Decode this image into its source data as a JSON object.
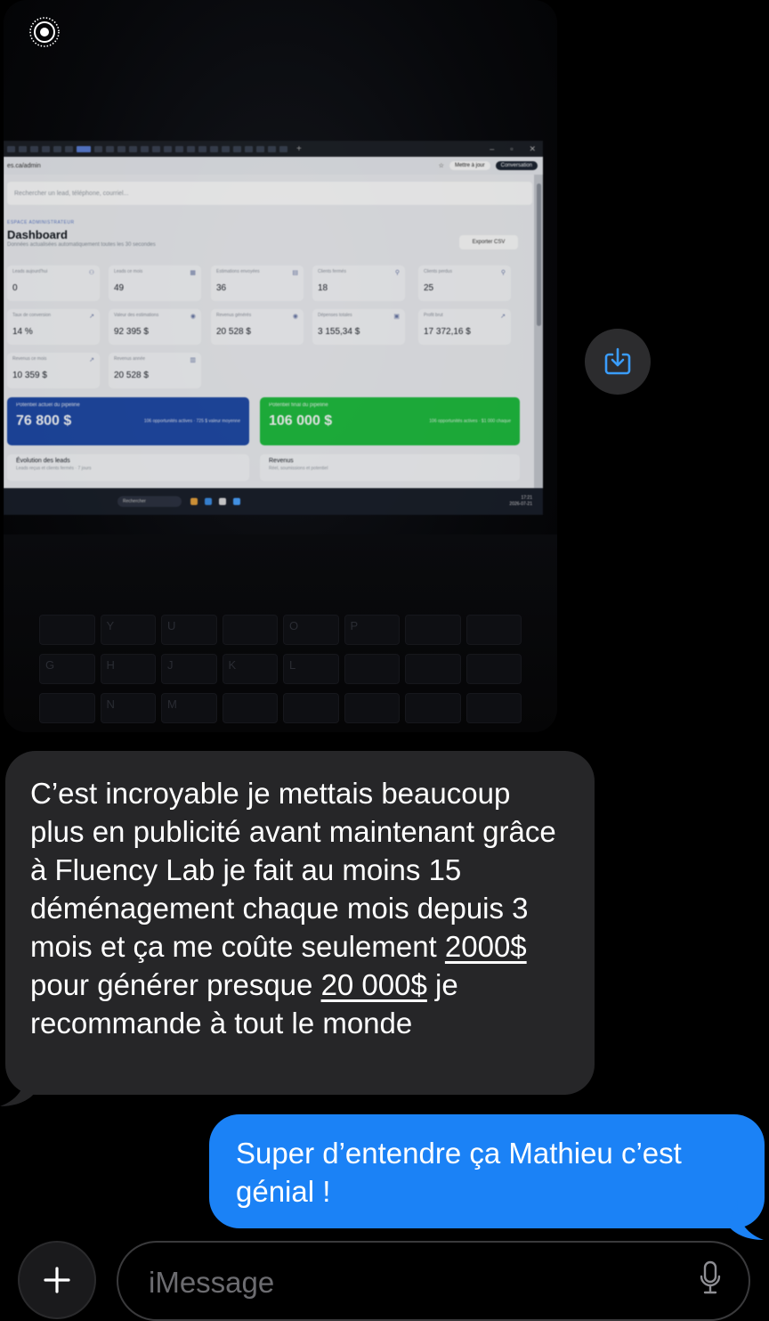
{
  "photo": {
    "browser": {
      "url": "es.ca/admin",
      "update_button": "Mettre à jour",
      "conversation_button": "Conversation"
    },
    "dashboard": {
      "search_placeholder": "Rechercher un lead, téléphone, courriel...",
      "eyebrow": "ESPACE ADMINISTRATEUR",
      "title": "Dashboard",
      "subtitle": "Données actualisées automatiquement toutes les 30 secondes",
      "export_button": "Exporter CSV",
      "stats": [
        {
          "label": "Leads aujourd'hui",
          "value": "0"
        },
        {
          "label": "Leads ce mois",
          "value": "49"
        },
        {
          "label": "Estimations envoyées",
          "value": "36"
        },
        {
          "label": "Clients fermés",
          "value": "18"
        },
        {
          "label": "Clients perdus",
          "value": "25"
        },
        {
          "label": "Taux de conversion",
          "value": "14 %"
        },
        {
          "label": "Valeur des estimations",
          "value": "92 395 $"
        },
        {
          "label": "Revenus générés",
          "value": "20 528 $"
        },
        {
          "label": "Dépenses totales",
          "value": "3 155,34 $"
        },
        {
          "label": "Profit brut",
          "value": "17 372,16 $"
        },
        {
          "label": "Revenus ce mois",
          "value": "10 359 $"
        },
        {
          "label": "Revenus année",
          "value": "20 528 $"
        }
      ],
      "pipeline_current": {
        "label": "Potentiel actuel du pipeline",
        "value": "76 800 $",
        "meta": "106 opportunités actives · 725 $ valeur moyenne",
        "color": "#1f4aa8"
      },
      "pipeline_final": {
        "label": "Potentiel final du pipeline",
        "value": "106 000 $",
        "meta": "106 opportunités actives · $1 000 chaque",
        "color": "#1fbf3f"
      },
      "leads_evolution": {
        "title": "Évolution des leads",
        "subtitle": "Leads reçus et clients fermés · 7 jours"
      },
      "revenue": {
        "title": "Revenus",
        "subtitle": "Réel, soumissions et potentiel"
      },
      "taskbar_search": "Rechercher",
      "clock_time": "17:21",
      "clock_date": "2026-07-21"
    }
  },
  "incoming_message": {
    "text_before_1": "C’est incroyable je mettais beaucoup plus en publicité avant maintenant grâce à Fluency Lab je fait au moins 15 déménagement chaque mois depuis 3 mois et ça me coûte seulement ",
    "amount_1": "2000$",
    "text_between": " pour générer presque ",
    "amount_2": "20 000$",
    "text_after": " je recommande à tout le monde",
    "bubble_color": "#262628"
  },
  "outgoing_message": {
    "text": "Super d’entendre ça Mathieu c’est génial !",
    "bubble_color": "#1b82f6"
  },
  "composer": {
    "placeholder": "iMessage"
  },
  "icons": {
    "live_photo": "live-photo-icon",
    "save": "save-download-icon",
    "plus": "plus-icon",
    "mic": "microphone-icon"
  }
}
